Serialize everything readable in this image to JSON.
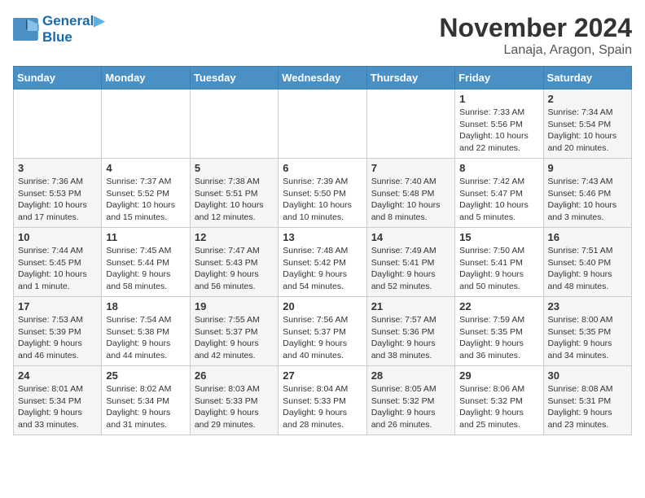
{
  "logo": {
    "line1": "General",
    "line2": "Blue"
  },
  "title": "November 2024",
  "location": "Lanaja, Aragon, Spain",
  "days_of_week": [
    "Sunday",
    "Monday",
    "Tuesday",
    "Wednesday",
    "Thursday",
    "Friday",
    "Saturday"
  ],
  "weeks": [
    [
      {
        "day": "",
        "info": ""
      },
      {
        "day": "",
        "info": ""
      },
      {
        "day": "",
        "info": ""
      },
      {
        "day": "",
        "info": ""
      },
      {
        "day": "",
        "info": ""
      },
      {
        "day": "1",
        "info": "Sunrise: 7:33 AM\nSunset: 5:56 PM\nDaylight: 10 hours\nand 22 minutes."
      },
      {
        "day": "2",
        "info": "Sunrise: 7:34 AM\nSunset: 5:54 PM\nDaylight: 10 hours\nand 20 minutes."
      }
    ],
    [
      {
        "day": "3",
        "info": "Sunrise: 7:36 AM\nSunset: 5:53 PM\nDaylight: 10 hours\nand 17 minutes."
      },
      {
        "day": "4",
        "info": "Sunrise: 7:37 AM\nSunset: 5:52 PM\nDaylight: 10 hours\nand 15 minutes."
      },
      {
        "day": "5",
        "info": "Sunrise: 7:38 AM\nSunset: 5:51 PM\nDaylight: 10 hours\nand 12 minutes."
      },
      {
        "day": "6",
        "info": "Sunrise: 7:39 AM\nSunset: 5:50 PM\nDaylight: 10 hours\nand 10 minutes."
      },
      {
        "day": "7",
        "info": "Sunrise: 7:40 AM\nSunset: 5:48 PM\nDaylight: 10 hours\nand 8 minutes."
      },
      {
        "day": "8",
        "info": "Sunrise: 7:42 AM\nSunset: 5:47 PM\nDaylight: 10 hours\nand 5 minutes."
      },
      {
        "day": "9",
        "info": "Sunrise: 7:43 AM\nSunset: 5:46 PM\nDaylight: 10 hours\nand 3 minutes."
      }
    ],
    [
      {
        "day": "10",
        "info": "Sunrise: 7:44 AM\nSunset: 5:45 PM\nDaylight: 10 hours\nand 1 minute."
      },
      {
        "day": "11",
        "info": "Sunrise: 7:45 AM\nSunset: 5:44 PM\nDaylight: 9 hours\nand 58 minutes."
      },
      {
        "day": "12",
        "info": "Sunrise: 7:47 AM\nSunset: 5:43 PM\nDaylight: 9 hours\nand 56 minutes."
      },
      {
        "day": "13",
        "info": "Sunrise: 7:48 AM\nSunset: 5:42 PM\nDaylight: 9 hours\nand 54 minutes."
      },
      {
        "day": "14",
        "info": "Sunrise: 7:49 AM\nSunset: 5:41 PM\nDaylight: 9 hours\nand 52 minutes."
      },
      {
        "day": "15",
        "info": "Sunrise: 7:50 AM\nSunset: 5:41 PM\nDaylight: 9 hours\nand 50 minutes."
      },
      {
        "day": "16",
        "info": "Sunrise: 7:51 AM\nSunset: 5:40 PM\nDaylight: 9 hours\nand 48 minutes."
      }
    ],
    [
      {
        "day": "17",
        "info": "Sunrise: 7:53 AM\nSunset: 5:39 PM\nDaylight: 9 hours\nand 46 minutes."
      },
      {
        "day": "18",
        "info": "Sunrise: 7:54 AM\nSunset: 5:38 PM\nDaylight: 9 hours\nand 44 minutes."
      },
      {
        "day": "19",
        "info": "Sunrise: 7:55 AM\nSunset: 5:37 PM\nDaylight: 9 hours\nand 42 minutes."
      },
      {
        "day": "20",
        "info": "Sunrise: 7:56 AM\nSunset: 5:37 PM\nDaylight: 9 hours\nand 40 minutes."
      },
      {
        "day": "21",
        "info": "Sunrise: 7:57 AM\nSunset: 5:36 PM\nDaylight: 9 hours\nand 38 minutes."
      },
      {
        "day": "22",
        "info": "Sunrise: 7:59 AM\nSunset: 5:35 PM\nDaylight: 9 hours\nand 36 minutes."
      },
      {
        "day": "23",
        "info": "Sunrise: 8:00 AM\nSunset: 5:35 PM\nDaylight: 9 hours\nand 34 minutes."
      }
    ],
    [
      {
        "day": "24",
        "info": "Sunrise: 8:01 AM\nSunset: 5:34 PM\nDaylight: 9 hours\nand 33 minutes."
      },
      {
        "day": "25",
        "info": "Sunrise: 8:02 AM\nSunset: 5:34 PM\nDaylight: 9 hours\nand 31 minutes."
      },
      {
        "day": "26",
        "info": "Sunrise: 8:03 AM\nSunset: 5:33 PM\nDaylight: 9 hours\nand 29 minutes."
      },
      {
        "day": "27",
        "info": "Sunrise: 8:04 AM\nSunset: 5:33 PM\nDaylight: 9 hours\nand 28 minutes."
      },
      {
        "day": "28",
        "info": "Sunrise: 8:05 AM\nSunset: 5:32 PM\nDaylight: 9 hours\nand 26 minutes."
      },
      {
        "day": "29",
        "info": "Sunrise: 8:06 AM\nSunset: 5:32 PM\nDaylight: 9 hours\nand 25 minutes."
      },
      {
        "day": "30",
        "info": "Sunrise: 8:08 AM\nSunset: 5:31 PM\nDaylight: 9 hours\nand 23 minutes."
      }
    ]
  ]
}
